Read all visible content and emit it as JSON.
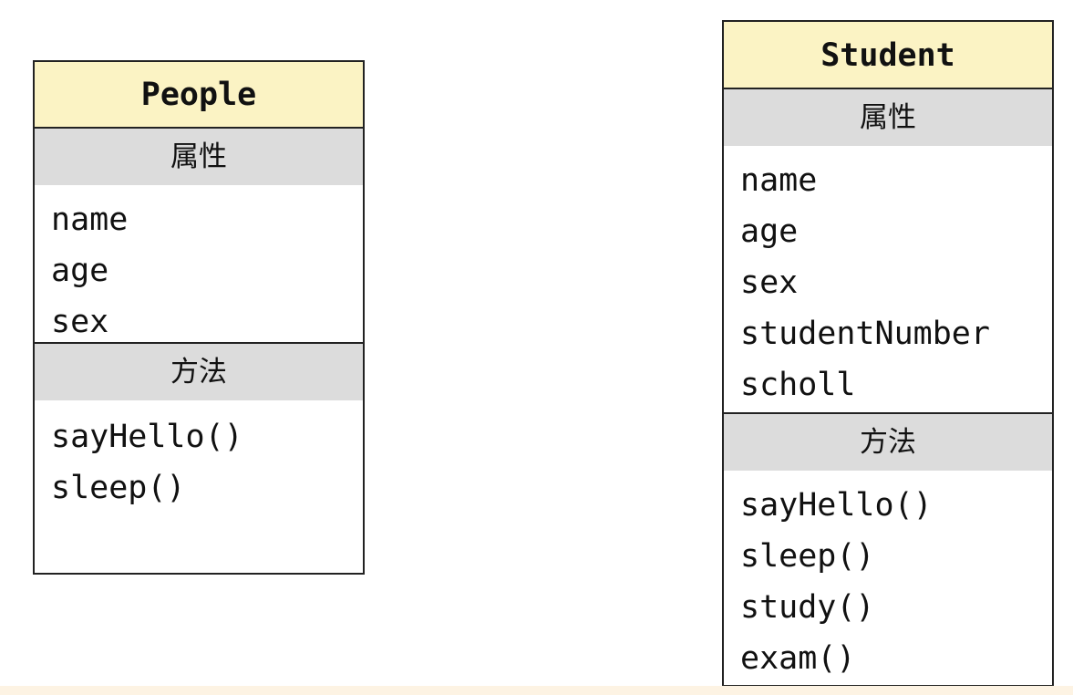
{
  "people": {
    "name": "People",
    "attributes_header": "属性",
    "attributes": [
      "name",
      "age",
      "sex"
    ],
    "methods_header": "方法",
    "methods": [
      "sayHello()",
      "sleep()"
    ]
  },
  "student": {
    "name": "Student",
    "attributes_header": "属性",
    "attributes": [
      "name",
      "age",
      "sex",
      "studentNumber",
      "scholl"
    ],
    "methods_header": "方法",
    "methods": [
      "sayHello()",
      "sleep()",
      "study()",
      "exam()"
    ]
  },
  "colors": {
    "class_name_bg": "#fbf3c4",
    "section_header_bg": "#dcdcdc",
    "border": "#222222"
  }
}
